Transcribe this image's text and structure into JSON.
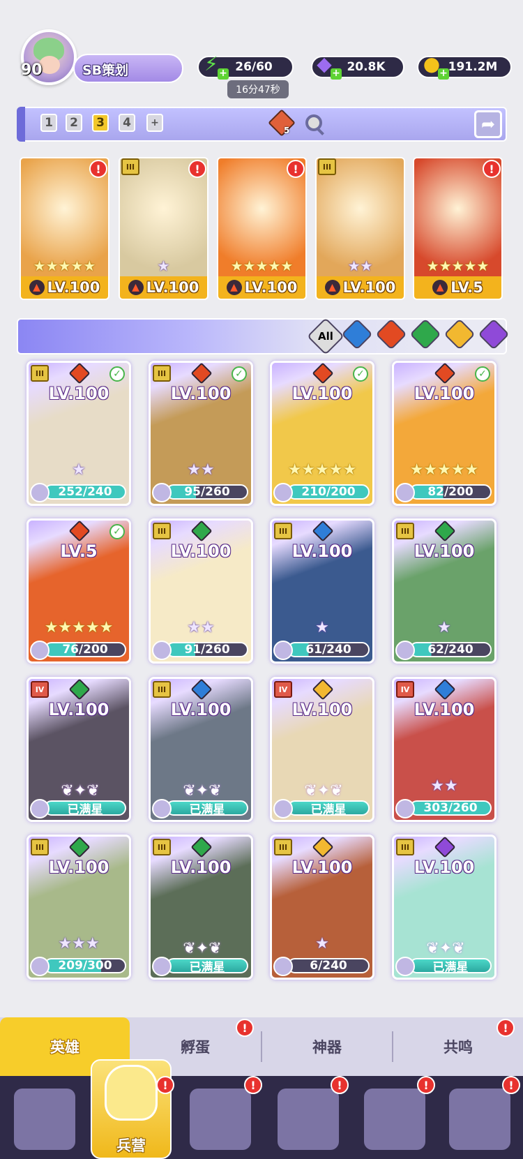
{
  "player": {
    "level": "90",
    "name": "SB策划"
  },
  "resources": {
    "energy": "26/60",
    "energy_timer": "16分47秒",
    "gems": "20.8K",
    "gold": "191.2M"
  },
  "team_bar": {
    "slots": [
      "1",
      "2",
      "3",
      "4",
      "+"
    ],
    "active_slot": "3",
    "badge_count": "5"
  },
  "team": [
    {
      "level": "LV.100",
      "stars": "★★★★★",
      "bg": "#e9a34a"
    },
    {
      "level": "LV.100",
      "stars": "★",
      "bg": "#d8c9a0"
    },
    {
      "level": "LV.100",
      "stars": "★★★★★",
      "bg": "#f07d2a"
    },
    {
      "level": "LV.100",
      "stars": "★★",
      "bg": "#e2a75a"
    },
    {
      "level": "LV.5",
      "stars": "★★★★★",
      "bg": "#d7492c"
    }
  ],
  "filters": {
    "all_label": "All",
    "colors": [
      "#2f7ed8",
      "#e24a22",
      "#2fa84b",
      "#f2b830",
      "#8f4ad8"
    ]
  },
  "heroes": [
    {
      "level": "LV.100",
      "progress": "252/240",
      "pct": 100,
      "stars": "★",
      "el": "#e24a22",
      "tier": "III",
      "check": true,
      "bg": "#e7dcc7"
    },
    {
      "level": "LV.100",
      "progress": "95/260",
      "pct": 36,
      "stars": "★★",
      "el": "#e24a22",
      "tier": "III",
      "check": true,
      "bg": "#c49b58"
    },
    {
      "level": "LV.100",
      "progress": "210/200",
      "pct": 100,
      "stars": "★★★★★",
      "el": "#e24a22",
      "tier": "",
      "check": true,
      "bg": "#f1c84a"
    },
    {
      "level": "LV.100",
      "progress": "82/200",
      "pct": 41,
      "stars": "★★★★★",
      "el": "#e24a22",
      "tier": "",
      "check": true,
      "bg": "#f3a83a"
    },
    {
      "level": "LV.5",
      "progress": "76/200",
      "pct": 38,
      "stars": "★★★★★",
      "el": "#e24a22",
      "tier": "",
      "check": true,
      "bg": "#e6642c"
    },
    {
      "level": "LV.100",
      "progress": "91/260",
      "pct": 35,
      "stars": "★★",
      "el": "#2fa84b",
      "tier": "III",
      "check": false,
      "bg": "#f6eac7"
    },
    {
      "level": "LV.100",
      "progress": "61/240",
      "pct": 25,
      "stars": "★",
      "el": "#2f7ed8",
      "tier": "III",
      "check": false,
      "bg": "#3b5a8f"
    },
    {
      "level": "LV.100",
      "progress": "62/240",
      "pct": 26,
      "stars": "★",
      "el": "#2fa84b",
      "tier": "III",
      "check": false,
      "bg": "#6aa26a"
    },
    {
      "level": "LV.100",
      "progress": "已满星",
      "pct": 100,
      "stars": "",
      "el": "#2fa84b",
      "tier": "IV",
      "check": false,
      "bg": "#5b5363",
      "wings": true
    },
    {
      "level": "LV.100",
      "progress": "已满星",
      "pct": 100,
      "stars": "",
      "el": "#2f7ed8",
      "tier": "III",
      "check": false,
      "bg": "#6d7887",
      "wings": true
    },
    {
      "level": "LV.100",
      "progress": "已满星",
      "pct": 100,
      "stars": "",
      "el": "#f2b830",
      "tier": "IV",
      "check": false,
      "bg": "#e8d8b5",
      "wings": true
    },
    {
      "level": "LV.100",
      "progress": "303/260",
      "pct": 100,
      "stars": "★★",
      "el": "#2f7ed8",
      "tier": "IV",
      "check": false,
      "bg": "#c9504a"
    },
    {
      "level": "LV.100",
      "progress": "209/300",
      "pct": 70,
      "stars": "★★★",
      "el": "#2fa84b",
      "tier": "III",
      "check": false,
      "bg": "#a8b98a"
    },
    {
      "level": "LV.100",
      "progress": "已满星",
      "pct": 100,
      "stars": "",
      "el": "#2fa84b",
      "tier": "III",
      "check": false,
      "bg": "#5c6e58",
      "wings": true
    },
    {
      "level": "LV.100",
      "progress": "6/240",
      "pct": 3,
      "stars": "★",
      "el": "#f2b830",
      "tier": "III",
      "check": false,
      "bg": "#b7603a"
    },
    {
      "level": "LV.100",
      "progress": "已满星",
      "pct": 100,
      "stars": "",
      "el": "#8f4ad8",
      "tier": "III",
      "check": false,
      "bg": "#a7e3d3",
      "wings": true
    }
  ],
  "tabs": [
    {
      "label": "英雄",
      "active": true,
      "alert": false
    },
    {
      "label": "孵蛋",
      "active": false,
      "alert": true
    },
    {
      "label": "神器",
      "active": false,
      "alert": false
    },
    {
      "label": "共鸣",
      "active": false,
      "alert": true
    }
  ],
  "nav": {
    "selected_label": "兵营"
  },
  "alert_glyph": "!"
}
